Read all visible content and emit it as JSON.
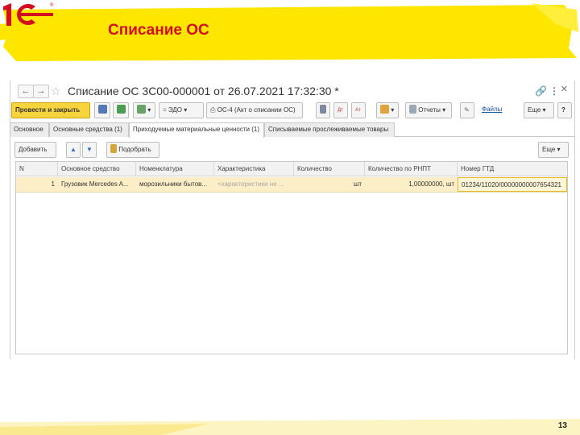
{
  "slide": {
    "title": "Списание ОС",
    "page_number": "13",
    "accent_color": "#ffe600",
    "title_color": "#d10f1f",
    "logo_icon": "1c-logo-icon"
  },
  "window": {
    "nav_back": "←",
    "nav_forward": "→",
    "favorite_icon": "☆",
    "title": "Списание ОС 3С00-000001 от 26.07.2021 17:32:30 *",
    "link_icon": "🔗",
    "menu_icon": "⋮",
    "close_icon": "×"
  },
  "toolbar": {
    "post_and_close": "Провести и закрыть",
    "edo": "ЭДО",
    "os4": "ОС-4 (Акт о списании ОС)",
    "reports": "Отчеты",
    "files": "Файлы",
    "more": "Еще"
  },
  "tabs": [
    "Основное",
    "Основные средства (1)",
    "Приходуемые материальные ценности (1)",
    "Списываемые прослеживаемые товары"
  ],
  "subtoolbar": {
    "add": "Добавить",
    "pick": "Подобрать",
    "more": "Еще"
  },
  "table": {
    "headers": [
      "N",
      "Основное средство",
      "Номенклатура",
      "Характеристика",
      "Количество",
      "Количество по РНПТ",
      "Номер ГТД"
    ],
    "rows": [
      [
        "1",
        "Грузовик Mercedes A...",
        "морозильники бытов...",
        "<характеристики не ...",
        "шт",
        "1,00000000, шт",
        "01234/11020/00000000007654321"
      ]
    ]
  }
}
